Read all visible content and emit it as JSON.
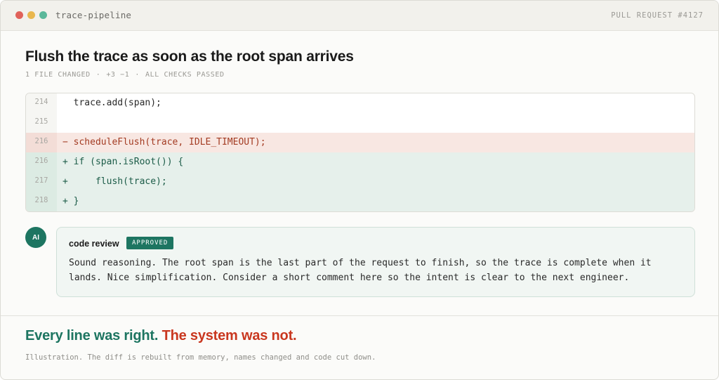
{
  "window": {
    "repo_name": "trace-pipeline",
    "pr_label": "PULL REQUEST #4127",
    "dots": [
      "#e0625a",
      "#e9b74e",
      "#5bb89a"
    ]
  },
  "pr": {
    "title": "Flush the trace as soon as the root span arrives",
    "meta": {
      "files_changed": "1 FILE CHANGED",
      "sep": "·",
      "diffstat": "+3 −1",
      "checks": "ALL CHECKS PASSED"
    }
  },
  "diff": {
    "lines": [
      {
        "num": "214",
        "type": "ctx",
        "text": "  trace.add(span);"
      },
      {
        "num": "215",
        "type": "ctx",
        "text": ""
      },
      {
        "num": "216",
        "type": "del",
        "text": "− scheduleFlush(trace, IDLE_TIMEOUT);"
      },
      {
        "num": "216",
        "type": "add",
        "text": "+ if (span.isRoot()) {"
      },
      {
        "num": "217",
        "type": "add",
        "text": "+     flush(trace);"
      },
      {
        "num": "218",
        "type": "add",
        "text": "+ }"
      }
    ]
  },
  "review": {
    "avatar_initials": "AI",
    "reviewer": "code review",
    "status": "APPROVED",
    "comment": "Sound reasoning. The root span is the last part of the request to finish, so the trace is complete when it lands. Nice simplification. Consider a short comment here so the intent is clear to the next engineer."
  },
  "footer": {
    "headline_good": "Every line was right.",
    "headline_bad": "The system was not.",
    "caption": "Illustration. The diff is rebuilt from memory, names changed and code cut down."
  },
  "colors": {
    "accent_green": "#1d7561",
    "accent_red": "#c9371f"
  }
}
